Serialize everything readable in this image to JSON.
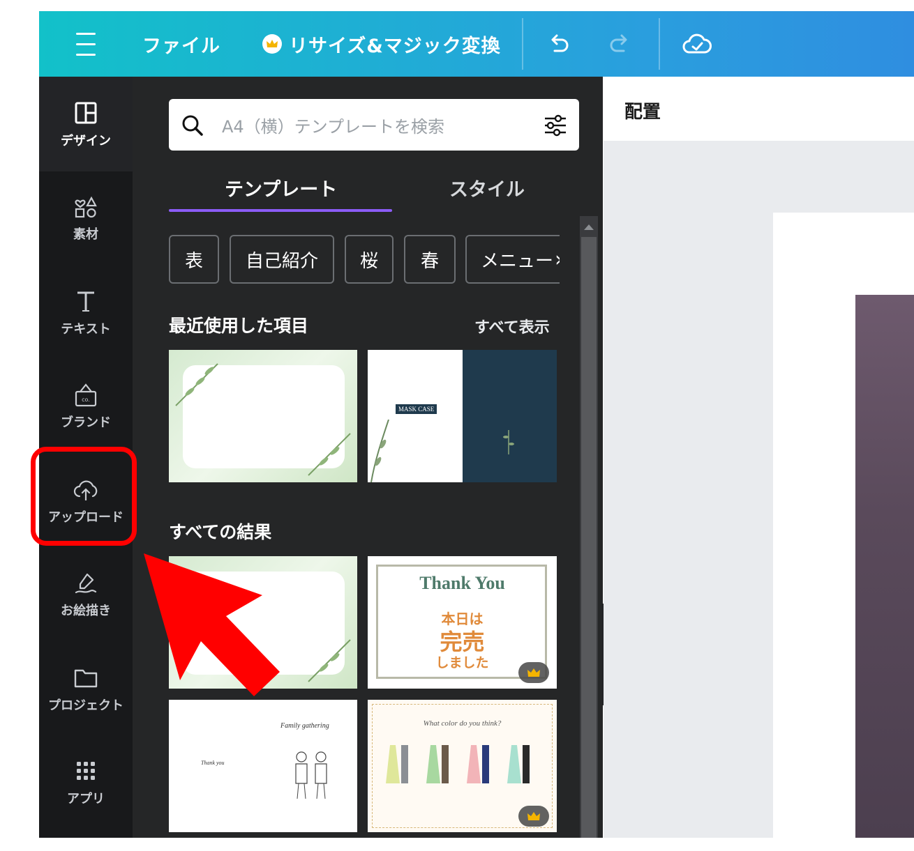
{
  "topbar": {
    "file_label": "ファイル",
    "resize_label": "リサイズ&マジック変換"
  },
  "rail": {
    "items": [
      {
        "label": "デザイン",
        "icon": "layout-icon"
      },
      {
        "label": "素材",
        "icon": "shapes-icon"
      },
      {
        "label": "テキスト",
        "icon": "text-icon"
      },
      {
        "label": "ブランド",
        "icon": "brand-icon"
      },
      {
        "label": "アップロード",
        "icon": "upload-cloud-icon"
      },
      {
        "label": "お絵描き",
        "icon": "draw-icon"
      },
      {
        "label": "プロジェクト",
        "icon": "folder-icon"
      },
      {
        "label": "アプリ",
        "icon": "apps-grid-icon"
      }
    ]
  },
  "panel": {
    "search_placeholder": "A4（横）テンプレートを検索",
    "tabs": [
      "テンプレート",
      "スタイル"
    ],
    "chips": [
      "表",
      "自己紹介",
      "桜",
      "春",
      "メニュー"
    ],
    "recent_title": "最近使用した項目",
    "see_all": "すべて表示",
    "all_results_title": "すべての結果"
  },
  "thumbnails": {
    "mask_case_label": "MASK CASE",
    "thank_you_heading": "Thank You",
    "sold_out_line1": "本日は",
    "sold_out_line2": "完売",
    "sold_out_line3": "しました",
    "thank_you_small": "Thank you",
    "family_gathering": "Family gathering",
    "dress_title": "What color do you think?"
  },
  "canvas": {
    "arrange_label": "配置"
  },
  "colors": {
    "topbar_start": "#12c1c9",
    "topbar_end": "#2f8ee0",
    "panel_bg": "#252627",
    "rail_bg": "#18191b",
    "accent_purple": "#8b5cf6",
    "highlight_red": "#ff0000"
  }
}
